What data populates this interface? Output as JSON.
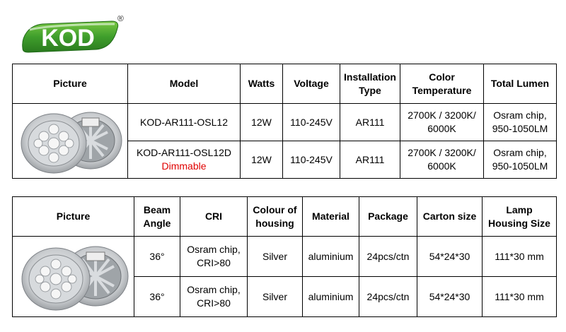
{
  "brand": {
    "name": "KOD",
    "registered": "®",
    "colors": {
      "green": "#3f9e2c",
      "dark_green": "#2a7a1e"
    }
  },
  "table1": {
    "headers": {
      "picture": "Picture",
      "model": "Model",
      "watts": "Watts",
      "voltage": "Voltage",
      "installation_1": "Installation",
      "installation_2": "Type",
      "color_temp_1": "Color",
      "color_temp_2": "Temperature",
      "lumen": "Total Lumen"
    },
    "rows": [
      {
        "model": "KOD-AR111-OSL12",
        "model_note": "",
        "watts": "12W",
        "voltage": "110-245V",
        "type": "AR111",
        "cct_1": "2700K / 3200K/",
        "cct_2": "6000K",
        "lumen_1": "Osram chip,",
        "lumen_2": "950-1050LM"
      },
      {
        "model": "KOD-AR111-OSL12D",
        "model_note": "Dimmable",
        "watts": "12W",
        "voltage": "110-245V",
        "type": "AR111",
        "cct_1": "2700K / 3200K/",
        "cct_2": "6000K",
        "lumen_1": "Osram chip,",
        "lumen_2": "950-1050LM"
      }
    ]
  },
  "table2": {
    "headers": {
      "picture": "Picture",
      "beam_1": "Beam",
      "beam_2": "Angle",
      "cri": "CRI",
      "colour_1": "Colour of",
      "colour_2": "housing",
      "material": "Material",
      "package": "Package",
      "carton": "Carton size",
      "housing_1": "Lamp",
      "housing_2": "Housing Size"
    },
    "rows": [
      {
        "beam": "36°",
        "cri_1": "Osram chip,",
        "cri_2": "CRI>80",
        "colour": "Silver",
        "material": "aluminium",
        "package": "24pcs/ctn",
        "carton": "54*24*30",
        "housing": "111*30 mm"
      },
      {
        "beam": "36°",
        "cri_1": "Osram chip,",
        "cri_2": "CRI>80",
        "colour": "Silver",
        "material": "aluminium",
        "package": "24pcs/ctn",
        "carton": "54*24*30",
        "housing": "111*30 mm"
      }
    ]
  }
}
